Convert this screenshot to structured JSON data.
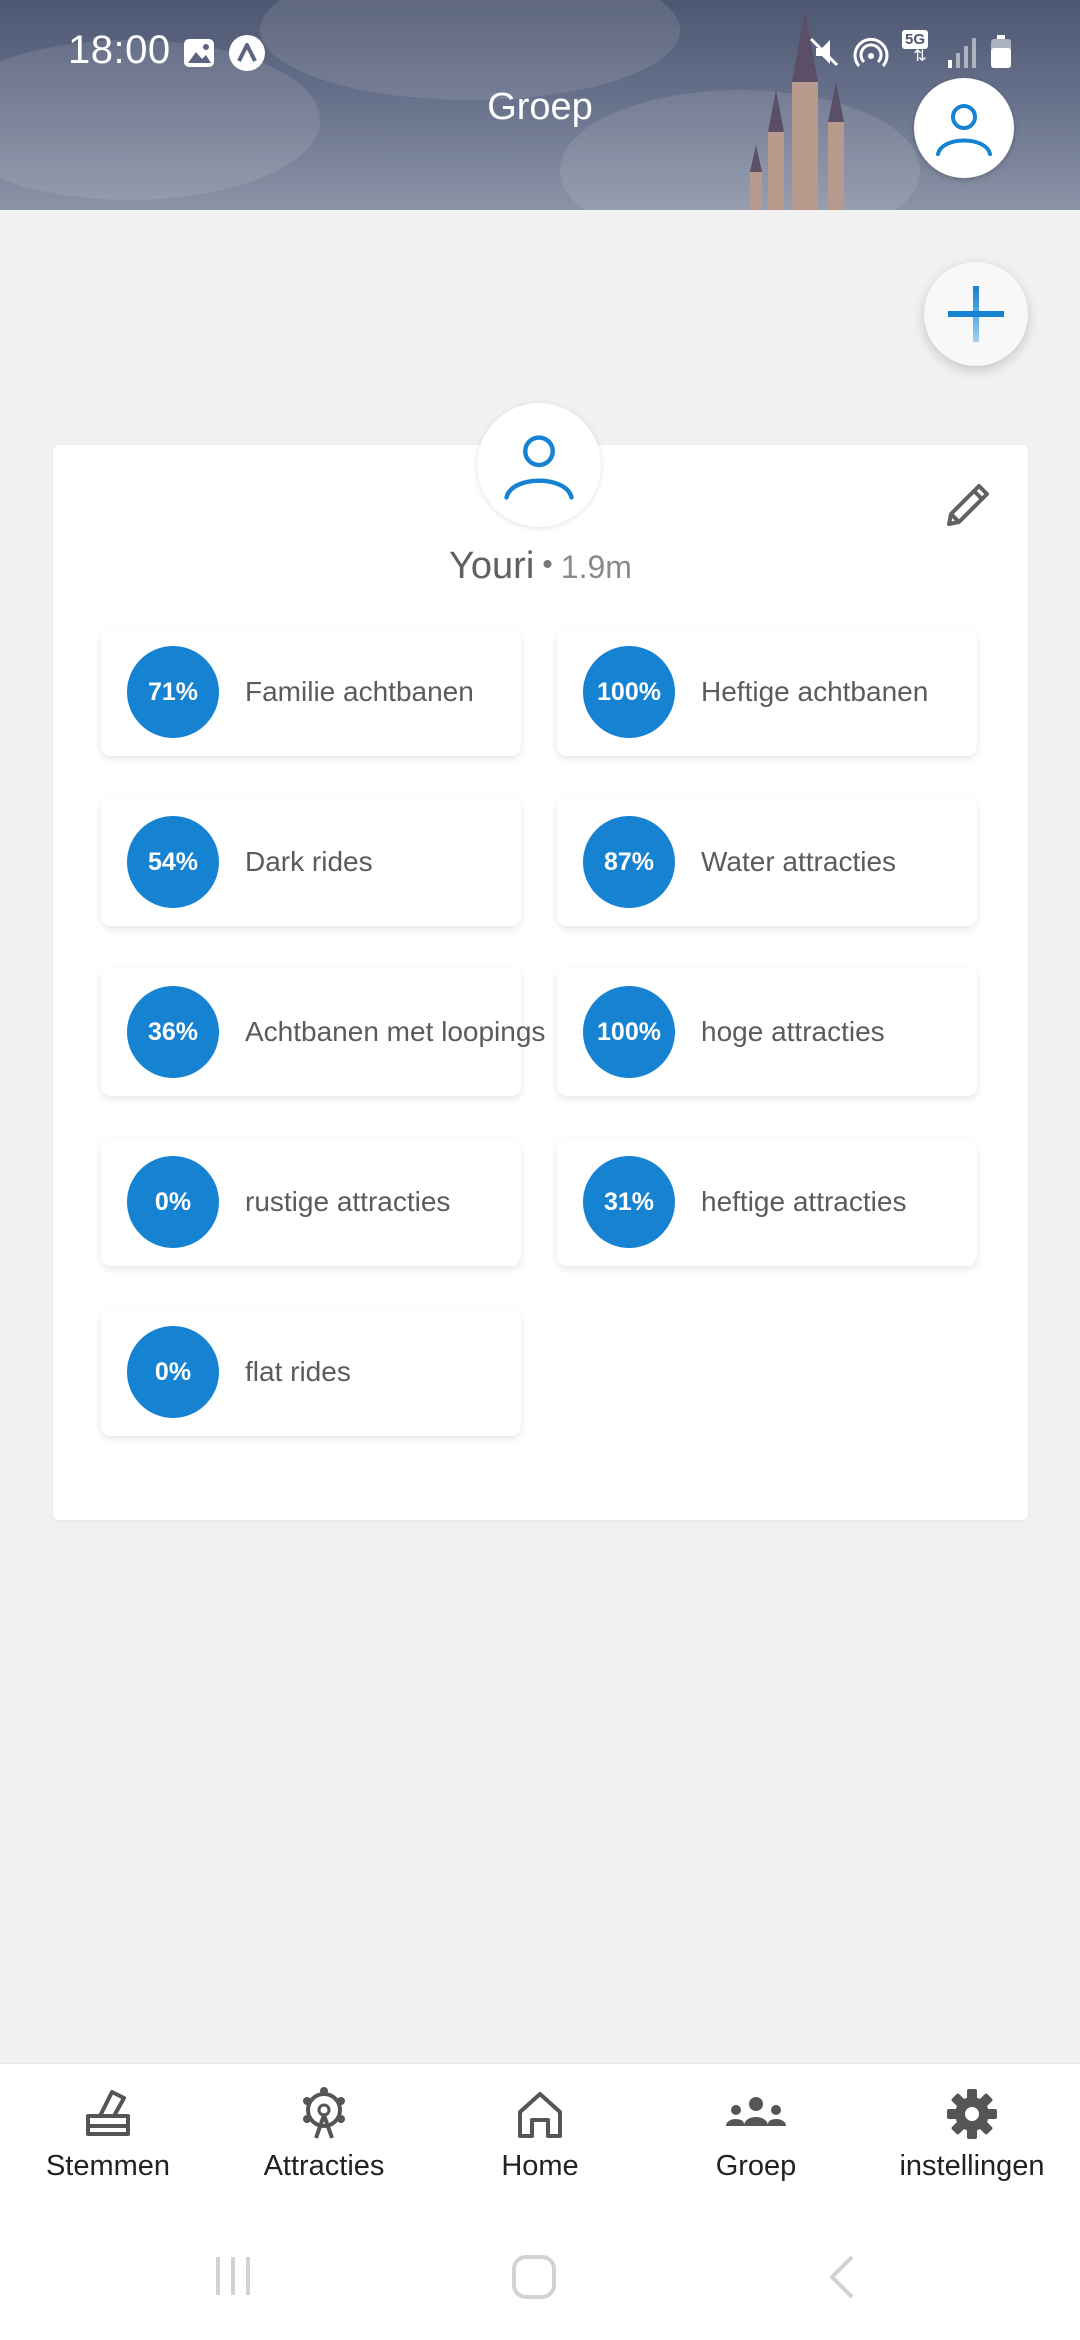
{
  "status_bar": {
    "time": "18:00",
    "network_label": "5G"
  },
  "header": {
    "title": "Groep"
  },
  "member": {
    "name": "Youri",
    "separator": "•",
    "height": "1.9m"
  },
  "preferences": [
    {
      "percent": "71%",
      "label": "Familie achtbanen"
    },
    {
      "percent": "100%",
      "label": "Heftige achtbanen"
    },
    {
      "percent": "54%",
      "label": "Dark rides"
    },
    {
      "percent": "87%",
      "label": "Water attracties"
    },
    {
      "percent": "36%",
      "label": "Achtbanen met loopings"
    },
    {
      "percent": "100%",
      "label": "hoge attracties"
    },
    {
      "percent": "0%",
      "label": "rustige attracties"
    },
    {
      "percent": "31%",
      "label": "heftige attracties"
    },
    {
      "percent": "0%",
      "label": "flat rides"
    }
  ],
  "bottom_nav": {
    "items": [
      {
        "label": "Stemmen",
        "icon": "ballot-box-icon"
      },
      {
        "label": "Attracties",
        "icon": "ferris-wheel-icon"
      },
      {
        "label": "Home",
        "icon": "home-icon"
      },
      {
        "label": "Groep",
        "icon": "group-icon"
      },
      {
        "label": "instellingen",
        "icon": "gear-icon"
      }
    ]
  },
  "colors": {
    "accent": "#1582d2",
    "background": "#f1f1f1",
    "card": "#ffffff"
  }
}
